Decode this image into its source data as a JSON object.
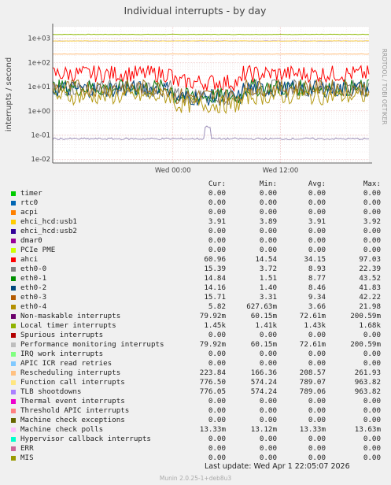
{
  "chart_data": {
    "type": "line",
    "title": "Individual interrupts - by day",
    "ylabel": "interrupts / second",
    "yscale": "log",
    "ylim": [
      0.007,
      3000
    ],
    "yticks": [
      "1e+03",
      "1e+02",
      "1e+01",
      "1e+00",
      "1e-01",
      "1e-02"
    ],
    "xticks": [
      "Wed 00:00",
      "Wed 12:00"
    ],
    "side_label": "RRDTOOL / TOBI OETIKER",
    "grid": true,
    "series_approx": [
      {
        "key": "timer_local",
        "color": "#8fb800",
        "level": 1450
      },
      {
        "key": "tlb",
        "color": "#a78af0",
        "level": 776
      },
      {
        "key": "function_call",
        "color": "#ffd94f",
        "level": 776
      },
      {
        "key": "rescheduling",
        "color": "#ffbe7d",
        "level": 224
      },
      {
        "key": "ahci",
        "color": "#ff0000",
        "level": 34
      },
      {
        "key": "eth0-0",
        "color": "#808080",
        "level": 9
      },
      {
        "key": "eth0-1",
        "color": "#0a7b12",
        "level": 9
      },
      {
        "key": "eth0-2",
        "color": "#004a8a",
        "level": 8
      },
      {
        "key": "eth0-3",
        "color": "#a4711d",
        "level": 9
      },
      {
        "key": "eth0-4",
        "color": "#b59b16",
        "level": 4
      },
      {
        "key": "nmi",
        "color": "#9c8fb8",
        "level": 0.07
      }
    ]
  },
  "legend": {
    "headers": [
      "Cur:",
      "Min:",
      "Avg:",
      "Max:"
    ],
    "rows": [
      {
        "name": "timer",
        "color": "#00cc00",
        "cur": "0.00",
        "min": "0.00",
        "avg": "0.00",
        "max": "0.00"
      },
      {
        "name": "rtc0",
        "color": "#0066b3",
        "cur": "0.00",
        "min": "0.00",
        "avg": "0.00",
        "max": "0.00"
      },
      {
        "name": "acpi",
        "color": "#ff8000",
        "cur": "0.00",
        "min": "0.00",
        "avg": "0.00",
        "max": "0.00"
      },
      {
        "name": "ehci_hcd:usb1",
        "color": "#ffcc00",
        "cur": "3.91",
        "min": "3.89",
        "avg": "3.91",
        "max": "3.92"
      },
      {
        "name": "ehci_hcd:usb2",
        "color": "#330099",
        "cur": "0.00",
        "min": "0.00",
        "avg": "0.00",
        "max": "0.00"
      },
      {
        "name": "dmar0",
        "color": "#990099",
        "cur": "0.00",
        "min": "0.00",
        "avg": "0.00",
        "max": "0.00"
      },
      {
        "name": "PCIe PME",
        "color": "#ccff00",
        "cur": "0.00",
        "min": "0.00",
        "avg": "0.00",
        "max": "0.00"
      },
      {
        "name": "ahci",
        "color": "#ff0000",
        "cur": "60.96",
        "min": "14.54",
        "avg": "34.15",
        "max": "97.03"
      },
      {
        "name": "eth0-0",
        "color": "#808080",
        "cur": "15.39",
        "min": "3.72",
        "avg": "8.93",
        "max": "22.39"
      },
      {
        "name": "eth0-1",
        "color": "#008f00",
        "cur": "14.84",
        "min": "1.51",
        "avg": "8.77",
        "max": "43.52"
      },
      {
        "name": "eth0-2",
        "color": "#00487d",
        "cur": "14.16",
        "min": "1.40",
        "avg": "8.46",
        "max": "41.83"
      },
      {
        "name": "eth0-3",
        "color": "#b35a00",
        "cur": "15.71",
        "min": "3.31",
        "avg": "9.34",
        "max": "42.22"
      },
      {
        "name": "eth0-4",
        "color": "#b38f00",
        "cur": "5.82",
        "min": "627.63m",
        "avg": "3.66",
        "max": "21.98"
      },
      {
        "name": "Non-maskable interrupts",
        "color": "#6b006b",
        "cur": "79.92m",
        "min": "60.15m",
        "avg": "72.61m",
        "max": "200.59m"
      },
      {
        "name": "Local timer interrupts",
        "color": "#8fb300",
        "cur": "1.45k",
        "min": "1.41k",
        "avg": "1.43k",
        "max": "1.68k"
      },
      {
        "name": "Spurious interrupts",
        "color": "#b30000",
        "cur": "0.00",
        "min": "0.00",
        "avg": "0.00",
        "max": "0.00"
      },
      {
        "name": "Performance monitoring interrupts",
        "color": "#bebebe",
        "cur": "79.92m",
        "min": "60.15m",
        "avg": "72.61m",
        "max": "200.59m"
      },
      {
        "name": "IRQ work interrupts",
        "color": "#80ff80",
        "cur": "0.00",
        "min": "0.00",
        "avg": "0.00",
        "max": "0.00"
      },
      {
        "name": "APIC ICR read retries",
        "color": "#80c9ff",
        "cur": "0.00",
        "min": "0.00",
        "avg": "0.00",
        "max": "0.00"
      },
      {
        "name": "Rescheduling interrupts",
        "color": "#ffc080",
        "cur": "223.84",
        "min": "166.36",
        "avg": "208.57",
        "max": "261.93"
      },
      {
        "name": "Function call interrupts",
        "color": "#ffe680",
        "cur": "776.50",
        "min": "574.24",
        "avg": "789.07",
        "max": "963.82"
      },
      {
        "name": "TLB shootdowns",
        "color": "#aa80ff",
        "cur": "776.05",
        "min": "574.24",
        "avg": "789.06",
        "max": "963.82"
      },
      {
        "name": "Thermal event interrupts",
        "color": "#ee00cc",
        "cur": "0.00",
        "min": "0.00",
        "avg": "0.00",
        "max": "0.00"
      },
      {
        "name": "Threshold APIC interrupts",
        "color": "#ff8080",
        "cur": "0.00",
        "min": "0.00",
        "avg": "0.00",
        "max": "0.00"
      },
      {
        "name": "Machine check exceptions",
        "color": "#666600",
        "cur": "0.00",
        "min": "0.00",
        "avg": "0.00",
        "max": "0.00"
      },
      {
        "name": "Machine check polls",
        "color": "#ffbfff",
        "cur": "13.33m",
        "min": "13.12m",
        "avg": "13.33m",
        "max": "13.63m"
      },
      {
        "name": "Hypervisor callback interrupts",
        "color": "#00ffcc",
        "cur": "0.00",
        "min": "0.00",
        "avg": "0.00",
        "max": "0.00"
      },
      {
        "name": "ERR",
        "color": "#cc6699",
        "cur": "0.00",
        "min": "0.00",
        "avg": "0.00",
        "max": "0.00"
      },
      {
        "name": "MIS",
        "color": "#999900",
        "cur": "0.00",
        "min": "0.00",
        "avg": "0.00",
        "max": "0.00"
      }
    ]
  },
  "footer": {
    "last_update": "Last update: Wed Apr  1 22:05:07 2026",
    "version": "Munin 2.0.25-1+deb8u3"
  }
}
